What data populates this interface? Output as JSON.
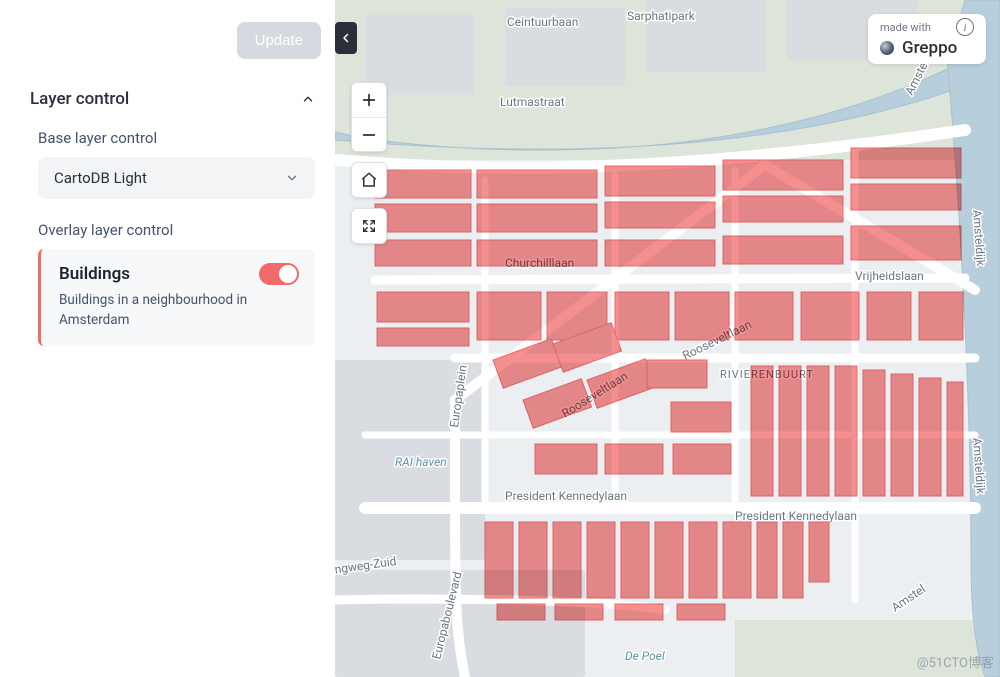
{
  "sidebar": {
    "update_label": "Update",
    "panel_title": "Layer control",
    "base_layer": {
      "label": "Base layer control",
      "selected": "CartoDB Light"
    },
    "overlay_layer": {
      "label": "Overlay layer control",
      "title": "Buildings",
      "description": "Buildings in a neighbourhood in Amsterdam",
      "enabled": true
    }
  },
  "map": {
    "roads": [
      "Ceintuurbaan",
      "Sarphatipark",
      "Lutmastraat",
      "Churchilllaan",
      "Vrijheidslaan",
      "Amsteldijk",
      "Amsteldijk",
      "Rooseveltlaan",
      "Rooseveltlaan",
      "President Kennedylaan",
      "President Kennedylaan",
      "Europaplein",
      "Europaboulevard",
      "Amstel",
      "Amstel",
      "RIVIERENBUURT",
      "De Poel",
      "RAI haven",
      "Ringweg-Zuid"
    ],
    "overlay_color": "#f48383",
    "overlay_stroke": "#ea5a5a"
  },
  "attribution": {
    "top": "made with",
    "brand": "Greppo"
  },
  "icons": {
    "zoom_in": "plus-icon",
    "zoom_out": "minus-icon",
    "home": "home-icon",
    "fullscreen": "fullscreen-icon",
    "collapse": "chevron-left-icon",
    "chevron_up": "chevron-up-icon",
    "chevron_down": "chevron-down-icon",
    "info": "info-icon"
  },
  "watermark": "@51CTO博客"
}
